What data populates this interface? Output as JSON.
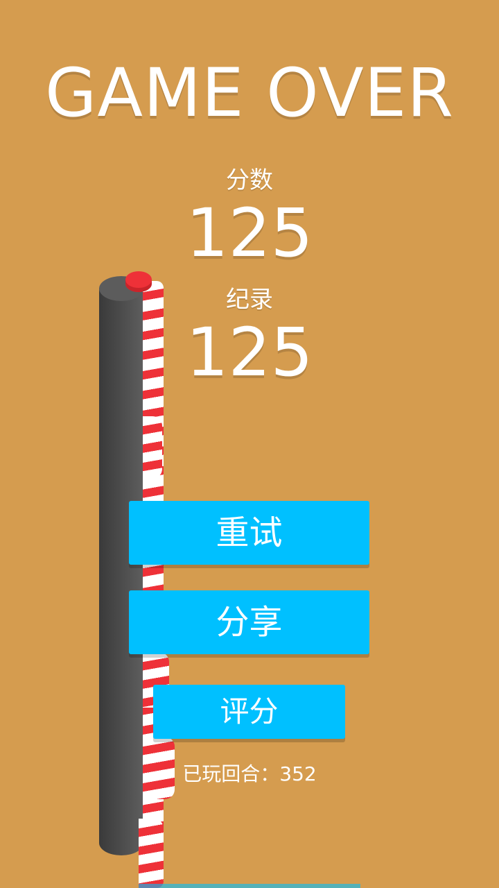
{
  "title": "GAME OVER",
  "score": {
    "label": "分数",
    "value": "125"
  },
  "record": {
    "label": "纪录",
    "value": "125"
  },
  "buttons": {
    "retry": "重试",
    "share": "分享",
    "rate": "评分"
  },
  "rounds_played": "已玩回合：352",
  "colors": {
    "background": "#D59C4F",
    "button": "#00C0FF",
    "stripe_red": "#EE3138",
    "pole": "#4A4A4A"
  }
}
